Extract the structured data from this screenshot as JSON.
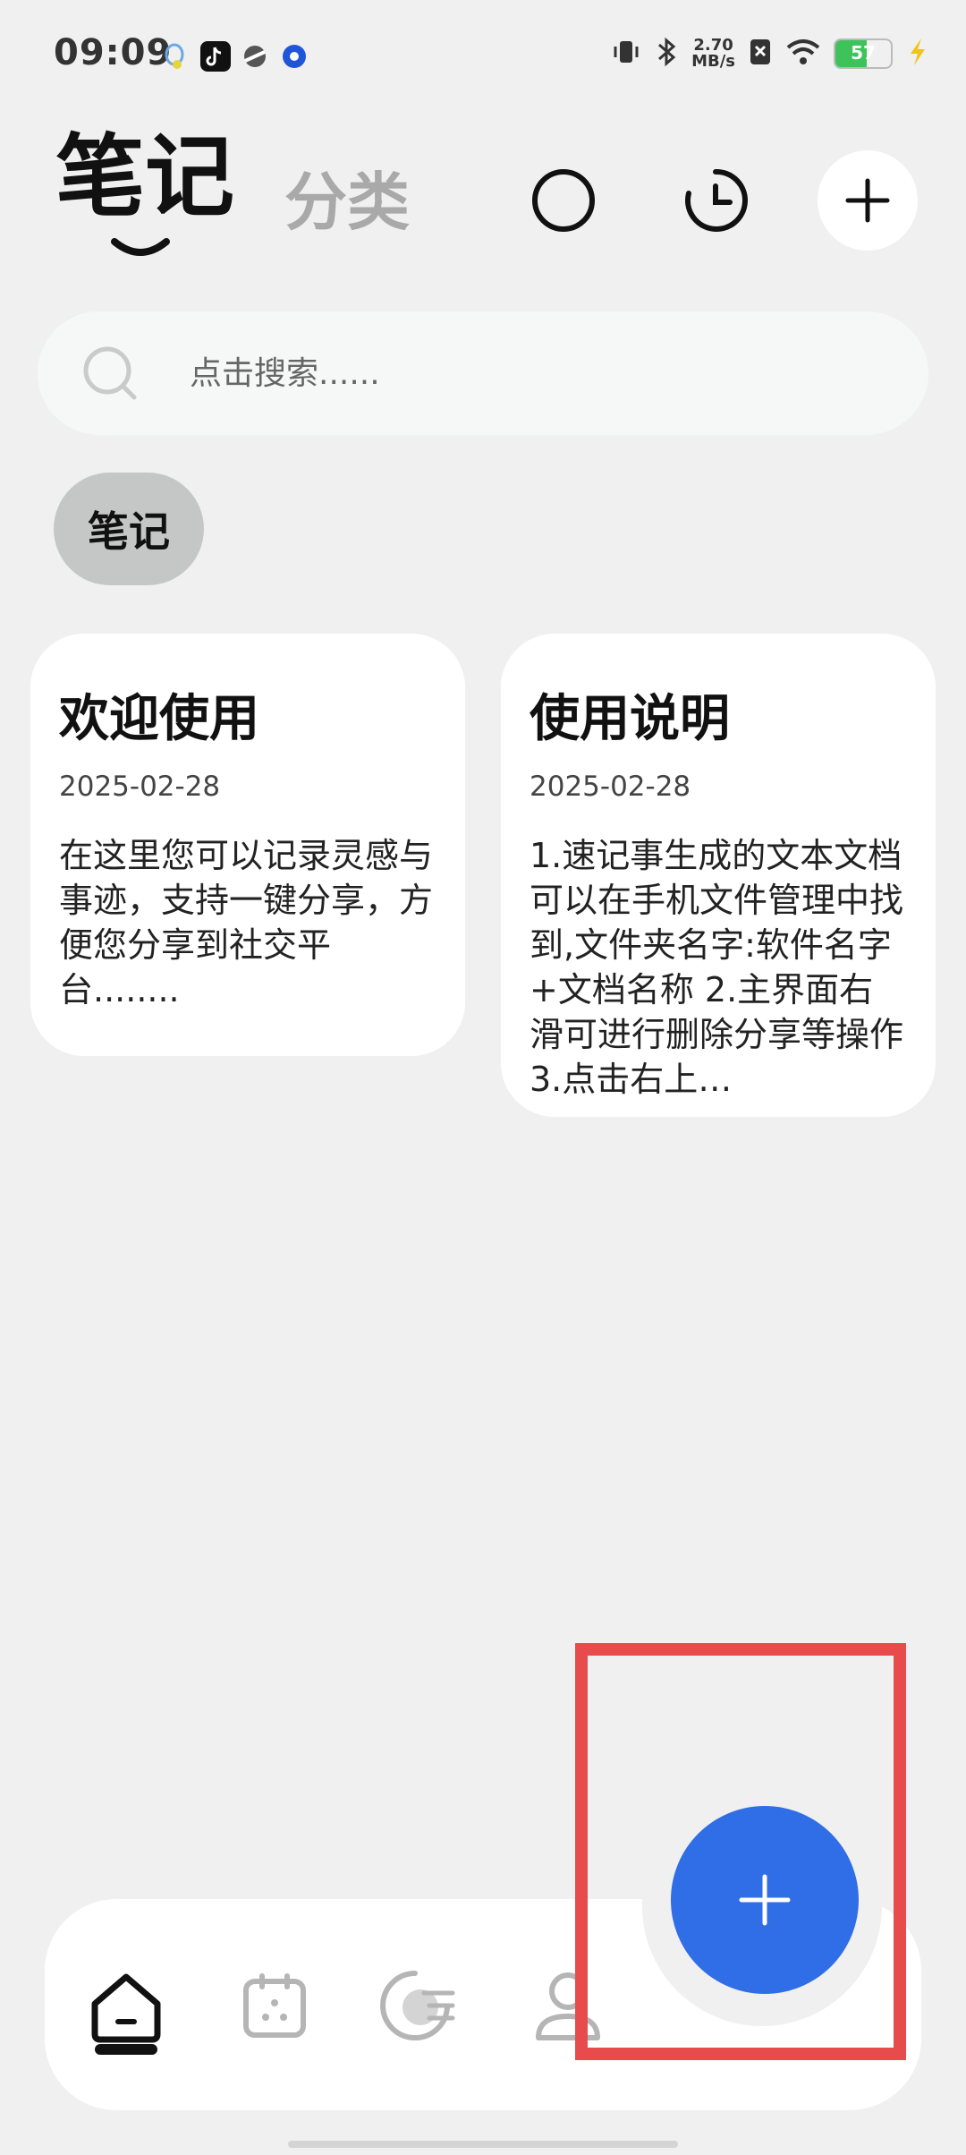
{
  "status_bar": {
    "time": "09:09",
    "speed_value": "2.70",
    "speed_unit": "MB/s",
    "battery": "57",
    "battery_level": 0.57
  },
  "header": {
    "title_tab": "笔记",
    "category_tab": "分类"
  },
  "search": {
    "placeholder": "点击搜索......"
  },
  "filter_chip": "笔记",
  "notes": [
    {
      "title": "欢迎使用",
      "date": "2025-02-28",
      "body": "在这里您可以记录灵感与事迹，支持一键分享，方便您分享到社交平台........"
    },
    {
      "title": "使用说明",
      "date": "2025-02-28",
      "body": "1.速记事生成的文本文档可以在手机文件管理中找到,文件夹名字:软件名字+文档名称 2.主界面右滑可进行删除分享等操作 3.点击右上…"
    }
  ],
  "colors": {
    "background": "#eff0ef",
    "fab": "#2f6ee6",
    "highlight": "#e84b4b"
  }
}
